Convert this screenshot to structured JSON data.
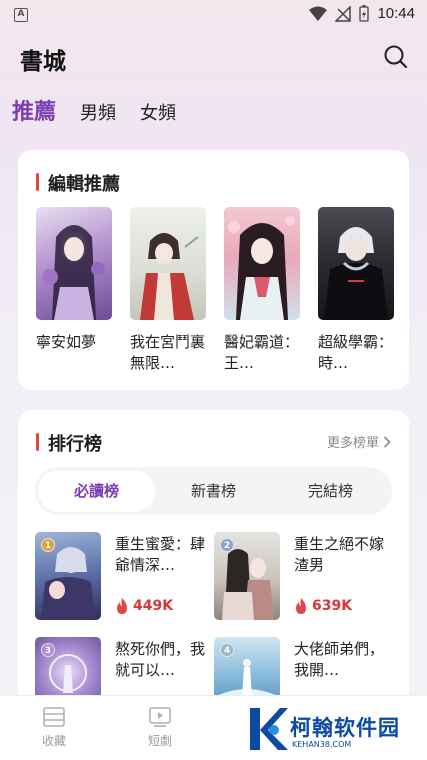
{
  "status_bar": {
    "time": "10:44",
    "left_icon": "A"
  },
  "header": {
    "title": "書城",
    "search_icon": "search-icon"
  },
  "top_tabs": [
    {
      "label": "推薦",
      "active": true
    },
    {
      "label": "男頻",
      "active": false
    },
    {
      "label": "女頻",
      "active": false
    }
  ],
  "editor_picks": {
    "title": "編輯推薦",
    "books": [
      {
        "name": "寧安如夢"
      },
      {
        "name": "我在宮鬥裏無限…"
      },
      {
        "name": "醫妃霸道：王…"
      },
      {
        "name": "超級學霸：時…"
      }
    ]
  },
  "rankings": {
    "title": "排行榜",
    "more": "更多榜單",
    "tabs": [
      {
        "label": "必讀榜",
        "active": true
      },
      {
        "label": "新書榜",
        "active": false
      },
      {
        "label": "完結榜",
        "active": false
      }
    ],
    "items": [
      {
        "rank": "1",
        "name": "重生蜜愛：肆爺情深…",
        "heat": "449K",
        "badge_color": "#d9a441"
      },
      {
        "rank": "2",
        "name": "重生之絕不嫁渣男",
        "heat": "639K",
        "badge_color": "#8aa4c8"
      },
      {
        "rank": "3",
        "name": "熬死你們，我就可以…",
        "heat": "",
        "badge_color": "#b48ad2"
      },
      {
        "rank": "4",
        "name": "大佬師弟們，我開…",
        "heat": "",
        "badge_color": "#9ab8c8"
      }
    ]
  },
  "bottom_nav": [
    {
      "label": "收藏",
      "icon": "bookshelf-icon"
    },
    {
      "label": "短劇",
      "icon": "video-icon"
    }
  ],
  "watermark": {
    "text": "柯翰软件园",
    "sub": "KEHAN38.COM"
  },
  "colors": {
    "accent": "#7b3fb4",
    "section_bar": "#e0474b",
    "heat": "#d8373a"
  }
}
